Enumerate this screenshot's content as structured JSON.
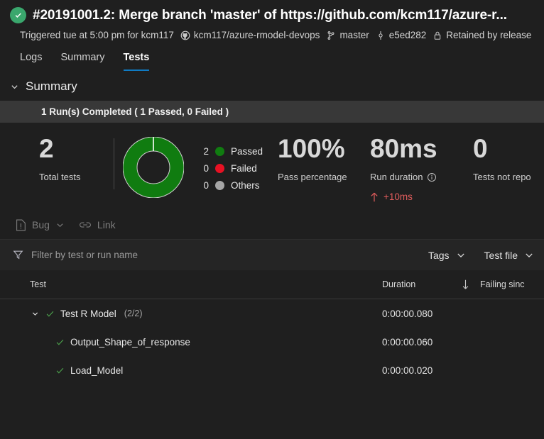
{
  "header": {
    "status_icon": "success-check-icon",
    "title": "#20191001.2: Merge branch 'master' of https://github.com/kcm117/azure-r...",
    "meta": {
      "triggered": "Triggered tue at 5:00 pm for kcm117",
      "repo_icon": "github-icon",
      "repo": "kcm117/azure-rmodel-devops",
      "branch_icon": "branch-icon",
      "branch": "master",
      "commit_icon": "commit-icon",
      "commit": "e5ed282",
      "lock_icon": "lock-icon",
      "retention": "Retained by release"
    }
  },
  "tabs": [
    {
      "label": "Logs",
      "active": false
    },
    {
      "label": "Summary",
      "active": false
    },
    {
      "label": "Tests",
      "active": true
    }
  ],
  "summary": {
    "section_label": "Summary",
    "collapse_icon": "chevron-down-icon",
    "run_status": "1 Run(s) Completed ( 1 Passed, 0 Failed )",
    "total_tests": {
      "value": "2",
      "caption": "Total tests"
    },
    "legend": [
      {
        "count": "2",
        "label": "Passed",
        "color": "#107c10"
      },
      {
        "count": "0",
        "label": "Failed",
        "color": "#e81123"
      },
      {
        "count": "0",
        "label": "Others",
        "color": "#a6a6a6"
      }
    ],
    "pass_percentage": {
      "value": "100%",
      "caption": "Pass percentage"
    },
    "run_duration": {
      "value": "80ms",
      "caption": "Run duration",
      "info_icon": "info-circle-icon",
      "delta_icon": "arrow-up-icon",
      "delta": "+10ms",
      "delta_color": "#e05c5c"
    },
    "tests_not_reported": {
      "value": "0",
      "caption": "Tests not repo"
    }
  },
  "actions": [
    {
      "label": "Bug",
      "icon": "bug-report-icon",
      "chevron": "chevron-down-icon"
    },
    {
      "label": "Link",
      "icon": "link-icon",
      "chevron": ""
    }
  ],
  "filter": {
    "icon": "filter-funnel-icon",
    "placeholder": "Filter by test or run name",
    "value": "",
    "dropdowns": [
      {
        "label": "Tags",
        "icon": "chevron-down-icon"
      },
      {
        "label": "Test file",
        "icon": "chevron-down-icon"
      }
    ]
  },
  "table": {
    "columns": {
      "test": "Test",
      "duration": "Duration",
      "sort_icon": "arrow-down-icon",
      "failing_since": "Failing sinc"
    },
    "rows": [
      {
        "level": 1,
        "expanded": true,
        "chevron": "chevron-down-icon",
        "status_icon": "check-icon",
        "name": "Test R Model",
        "count": "(2/2)",
        "duration": "0:00:00.080",
        "failing_since": ""
      },
      {
        "level": 2,
        "expanded": false,
        "chevron": "",
        "status_icon": "check-icon",
        "name": "Output_Shape_of_response",
        "count": "",
        "duration": "0:00:00.060",
        "failing_since": ""
      },
      {
        "level": 2,
        "expanded": false,
        "chevron": "",
        "status_icon": "check-icon",
        "name": "Load_Model",
        "count": "",
        "duration": "0:00:00.020",
        "failing_since": ""
      }
    ]
  },
  "theme": {
    "background": "#1f1f1f",
    "bar_background": "#383838",
    "accent_blue": "#0f7bc4",
    "pass_green": "#107c10",
    "badge_green": "#3aa76d",
    "fail_red": "#e81123"
  }
}
